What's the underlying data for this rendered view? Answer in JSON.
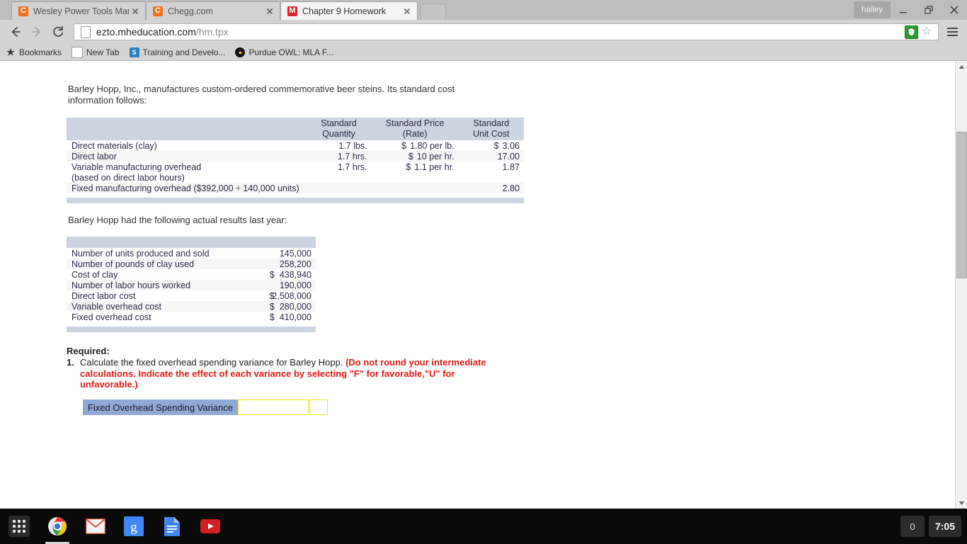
{
  "browser": {
    "tabs": [
      {
        "title": "Wesley Power Tools Manu",
        "favicon": "chegg-icon",
        "favicon_letter": "C",
        "active": false
      },
      {
        "title": "Chegg.com",
        "favicon": "chegg-icon",
        "favicon_letter": "C",
        "active": false
      },
      {
        "title": "Chapter 9 Homework",
        "favicon": "mcgraw-hill-icon",
        "favicon_letter": "M",
        "active": true
      }
    ],
    "profile_name": "hailey",
    "window_controls": [
      "minimize-button",
      "restore-button",
      "close-button"
    ],
    "nav": {
      "back": "back-button",
      "forward": "forward-button",
      "reload": "reload-button"
    },
    "omnibox": {
      "url_domain": "ezto.mheducation.com",
      "url_path": "/hm.tpx",
      "extension_icon": "extension-icon",
      "bookmark_star": "☆",
      "menu": "chrome-menu-button"
    },
    "bookmarks": [
      {
        "label": "Bookmarks",
        "icon": "star-icon"
      },
      {
        "label": "New Tab",
        "icon": "document-icon"
      },
      {
        "label": "Training and Develo...",
        "icon": "sharepoint-icon"
      },
      {
        "label": "Purdue OWL: MLA F...",
        "icon": "owl-icon"
      }
    ]
  },
  "page": {
    "intro1": "Barley Hopp, Inc., manufactures custom-ordered commemorative beer steins. Its standard cost information follows:",
    "intro2": "Barley Hopp had the following actual results last year:",
    "standard_cost_table": {
      "headers": [
        "",
        "Standard Quantity",
        "Standard Price (Rate)",
        "Standard Unit Cost"
      ],
      "header_line1": [
        "",
        "Standard",
        "Standard Price",
        "Standard"
      ],
      "header_line2": [
        "",
        "Quantity",
        "(Rate)",
        "Unit Cost"
      ],
      "rows": [
        {
          "label": "Direct materials (clay)",
          "qty": "1.7 lbs.",
          "price_sym": "$",
          "price": "1.80 per lb.",
          "cost_sym": "$",
          "cost": "3.06"
        },
        {
          "label": "Direct labor",
          "qty": "1.7 hrs.",
          "price_sym": "$",
          "price": "10 per hr.",
          "cost_sym": "",
          "cost": "17.00"
        },
        {
          "label": "Variable manufacturing overhead",
          "qty": "1.7 hrs.",
          "price_sym": "$",
          "price": "1.1 per hr.",
          "cost_sym": "",
          "cost": "1.87"
        },
        {
          "label": " (based on direct labor hours)",
          "qty": "",
          "price_sym": "",
          "price": "",
          "cost_sym": "",
          "cost": ""
        },
        {
          "label": "Fixed manufacturing overhead ($392,000 ÷ 140,000 units)",
          "qty": "",
          "price_sym": "",
          "price": "",
          "cost_sym": "",
          "cost": "2.80"
        }
      ]
    },
    "actual_results_table": {
      "rows": [
        {
          "label": "Number of units produced and sold",
          "sym": "",
          "value": "145,000"
        },
        {
          "label": "Number of pounds of clay used",
          "sym": "",
          "value": "258,200"
        },
        {
          "label": "Cost of clay",
          "sym": "$",
          "value": "438,940"
        },
        {
          "label": "Number of labor hours worked",
          "sym": "",
          "value": "190,000"
        },
        {
          "label": "Direct labor cost",
          "sym": "$",
          "value": "2,508,000"
        },
        {
          "label": "Variable overhead cost",
          "sym": "$",
          "value": "280,000"
        },
        {
          "label": "Fixed overhead cost",
          "sym": "$",
          "value": "410,000"
        }
      ]
    },
    "required": {
      "heading": "Required:",
      "number": "1.",
      "question_black": "Calculate the fixed overhead spending variance for Barley Hopp.",
      "question_red": "(Do not round your intermediate calculations. Indicate the effect of each variance by selecting \"F\" for favorable,\"U\" for unfavorable.)",
      "answer_label": "Fixed Overhead Spending Variance",
      "answer_value": "",
      "answer_effect": "",
      "answer_input_placeholder": "",
      "label_color": "#8fa8d4",
      "input_border_color": "#f2e318"
    }
  },
  "shelf": {
    "launcher": "app-launcher-icon",
    "apps": [
      {
        "name": "chrome-icon",
        "active": true
      },
      {
        "name": "gmail-icon",
        "active": false
      },
      {
        "name": "google-search-icon",
        "active": false
      },
      {
        "name": "google-docs-icon",
        "active": false
      },
      {
        "name": "youtube-icon",
        "active": false
      }
    ],
    "notification_count": "0",
    "clock": "7:05"
  },
  "scrollbar": {
    "up_arrow": "scroll-up-arrow",
    "down_arrow": "scroll-down-arrow"
  }
}
